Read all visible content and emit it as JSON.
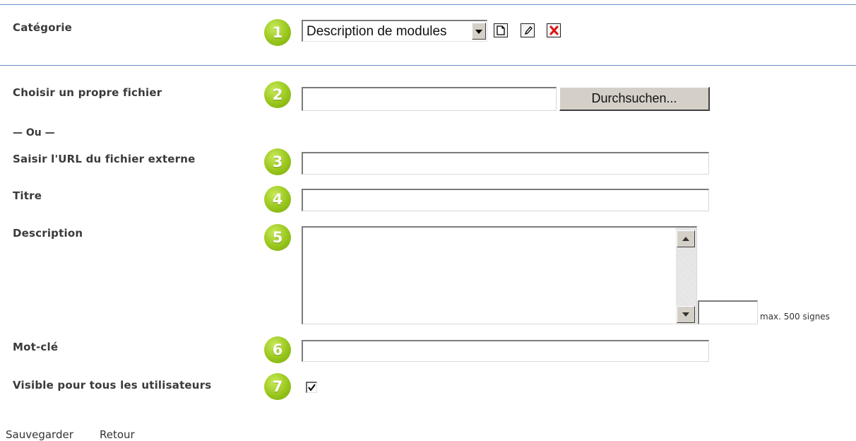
{
  "category": {
    "label": "Catégorie",
    "badge": "1",
    "selected": "Description de modules",
    "icons": [
      "new-document-icon",
      "edit-pencil-icon",
      "delete-x-icon"
    ]
  },
  "file": {
    "label": "Choisir un propre fichier",
    "badge": "2",
    "value": "",
    "browse_label": "Durchsuchen..."
  },
  "separator": "— Ou —",
  "url": {
    "label": "Saisir l'URL du fichier externe",
    "badge": "3",
    "value": ""
  },
  "title": {
    "label": "Titre",
    "badge": "4",
    "value": ""
  },
  "description": {
    "label": "Description",
    "badge": "5",
    "value": "",
    "counter_value": "",
    "max_hint": "max. 500 signes"
  },
  "keyword": {
    "label": "Mot-clé",
    "badge": "6",
    "value": ""
  },
  "visibility": {
    "label": "Visible pour tous les utilisateurs",
    "badge": "7",
    "checked": true
  },
  "footer": {
    "save": "Sauvegarder",
    "back": "Retour"
  },
  "colors": {
    "badge_green": "#98c61c",
    "rule_blue": "#6e8fc6",
    "delete_red": "#e01010"
  }
}
